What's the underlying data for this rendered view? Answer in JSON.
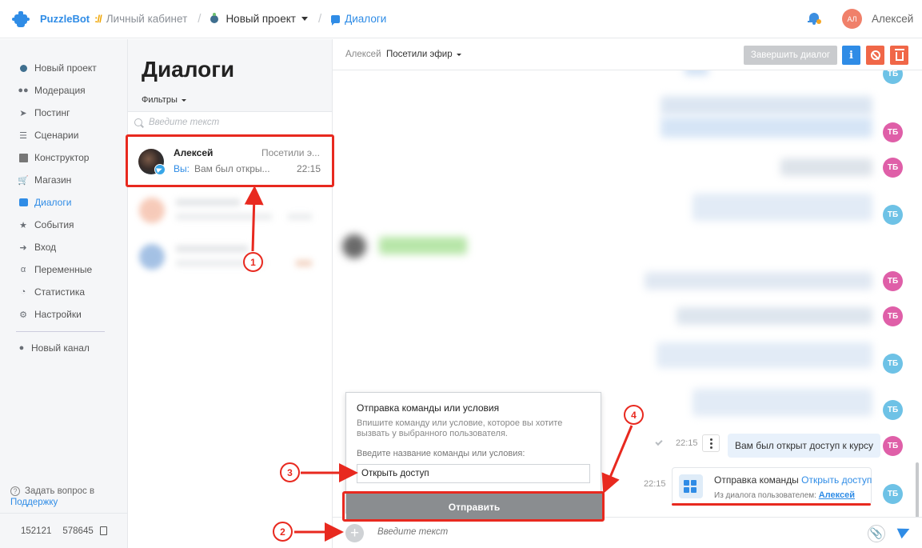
{
  "header": {
    "brand": "PuzzleBot",
    "brand_slashes": "://",
    "cabinet": "Личный кабинет",
    "project": "Новый проект",
    "section": "Диалоги",
    "user_initials": "АЛ",
    "user_name": "Алексей"
  },
  "sidebar": {
    "items": [
      {
        "label": "Новый проект",
        "icon": "project-icon"
      },
      {
        "label": "Модерация",
        "icon": "users-icon"
      },
      {
        "label": "Постинг",
        "icon": "paper-plane-icon"
      },
      {
        "label": "Сценарии",
        "icon": "scenario-icon"
      },
      {
        "label": "Конструктор",
        "icon": "grid-icon"
      },
      {
        "label": "Магазин",
        "icon": "cart-icon"
      },
      {
        "label": "Диалоги",
        "icon": "chat-icon"
      },
      {
        "label": "События",
        "icon": "star-icon"
      },
      {
        "label": "Вход",
        "icon": "login-icon"
      },
      {
        "label": "Переменные",
        "icon": "variable-icon"
      },
      {
        "label": "Статистика",
        "icon": "pie-chart-icon"
      },
      {
        "label": "Настройки",
        "icon": "gear-icon"
      }
    ],
    "new_channel": "Новый канал",
    "support_prefix": "Задать вопрос в",
    "support_link": "Поддержку",
    "id1": "152121",
    "id2": "578645"
  },
  "dialogs": {
    "title": "Диалоги",
    "filters": "Фильтры",
    "search_placeholder": "Введите текст",
    "item": {
      "name": "Алексей",
      "tag": "Посетили э...",
      "you": "Вы:",
      "preview": "Вам был откры...",
      "time": "22:15"
    }
  },
  "chat": {
    "user": "Алексей",
    "tag": "Посетили эфир",
    "finish_button": "Завершить диалог",
    "info_button": "i",
    "avatar_initials": "ТБ",
    "message_time": "22:15",
    "message_text": "Вам был открыт доступ к курсу",
    "card_time": "22:15",
    "card_title": "Отправка команды",
    "card_command": "Открыть доступ",
    "card_sub": "Из диалога пользователем:",
    "card_user": "Алексей",
    "composer_placeholder": "Введите текст"
  },
  "popup": {
    "title": "Отправка команды или условия",
    "description": "Впишите команду или условие, которое вы хотите вызвать у выбранного пользователя.",
    "field_label": "Введите название команды или условия:",
    "field_value": "Открыть доступ",
    "send_button": "Отправить"
  },
  "annotations": {
    "n1": "1",
    "n2": "2",
    "n3": "3",
    "n4": "4",
    "color": "#e8291f"
  },
  "colors": {
    "accent": "#2f8ce6",
    "danger": "#f06748",
    "avatar_pink": "#df5fa8",
    "avatar_blue": "#6ec2e6"
  }
}
